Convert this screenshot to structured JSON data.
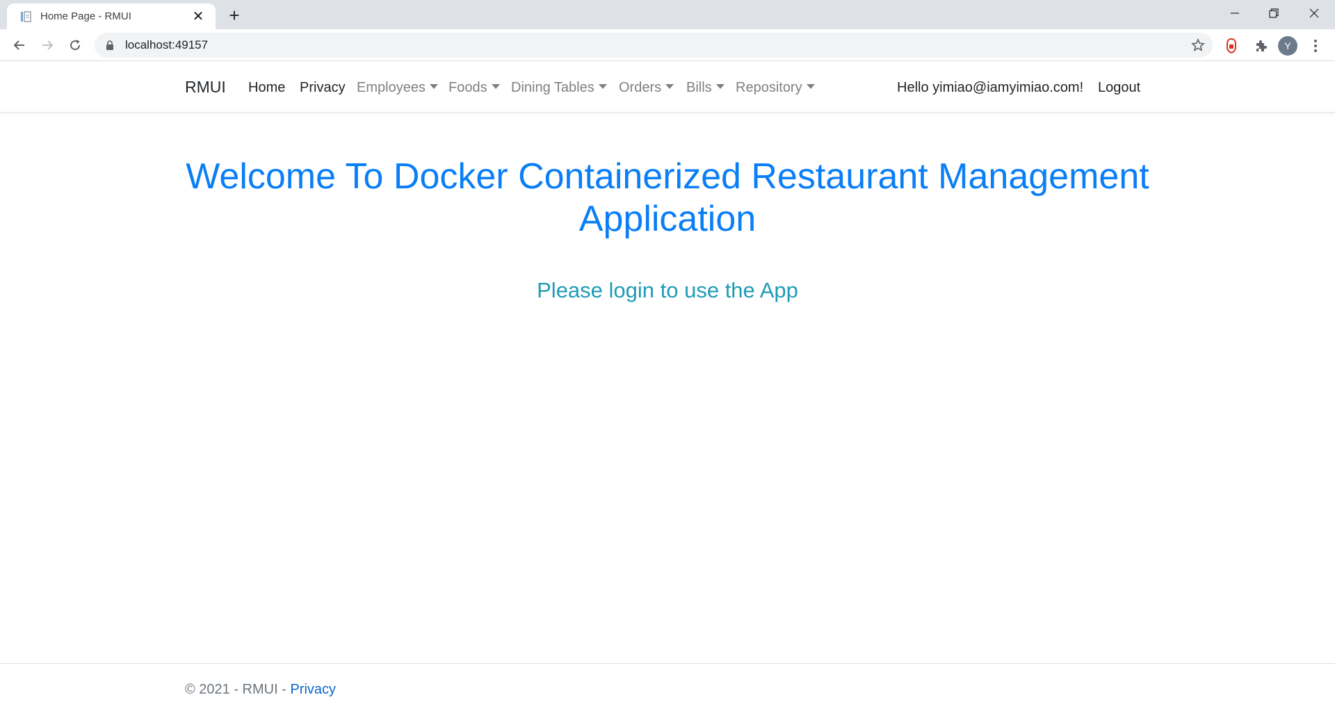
{
  "browser": {
    "tab_title": "Home Page - RMUI",
    "new_tab_symbol": "+",
    "close_symbol": "✕",
    "url": "localhost:49157",
    "avatar_letter": "Y"
  },
  "navbar": {
    "brand": "RMUI",
    "links": {
      "home": "Home",
      "privacy": "Privacy"
    },
    "dropdowns": {
      "employees": "Employees",
      "foods": "Foods",
      "dining_tables": "Dining Tables",
      "orders": "Orders",
      "bills": "Bills",
      "repository": "Repository"
    },
    "greeting": "Hello yimiao@iamyimiao.com!",
    "logout": "Logout"
  },
  "main": {
    "heading": "Welcome To Docker Containerized Restaurant Management Application",
    "subheading": "Please login to use the App"
  },
  "footer": {
    "copyright": "© 2021 - RMUI - ",
    "privacy_link": "Privacy"
  },
  "colors": {
    "heading": "#0a7ef7",
    "subheading": "#1e9bb6",
    "footer_link": "#0a67c9"
  }
}
